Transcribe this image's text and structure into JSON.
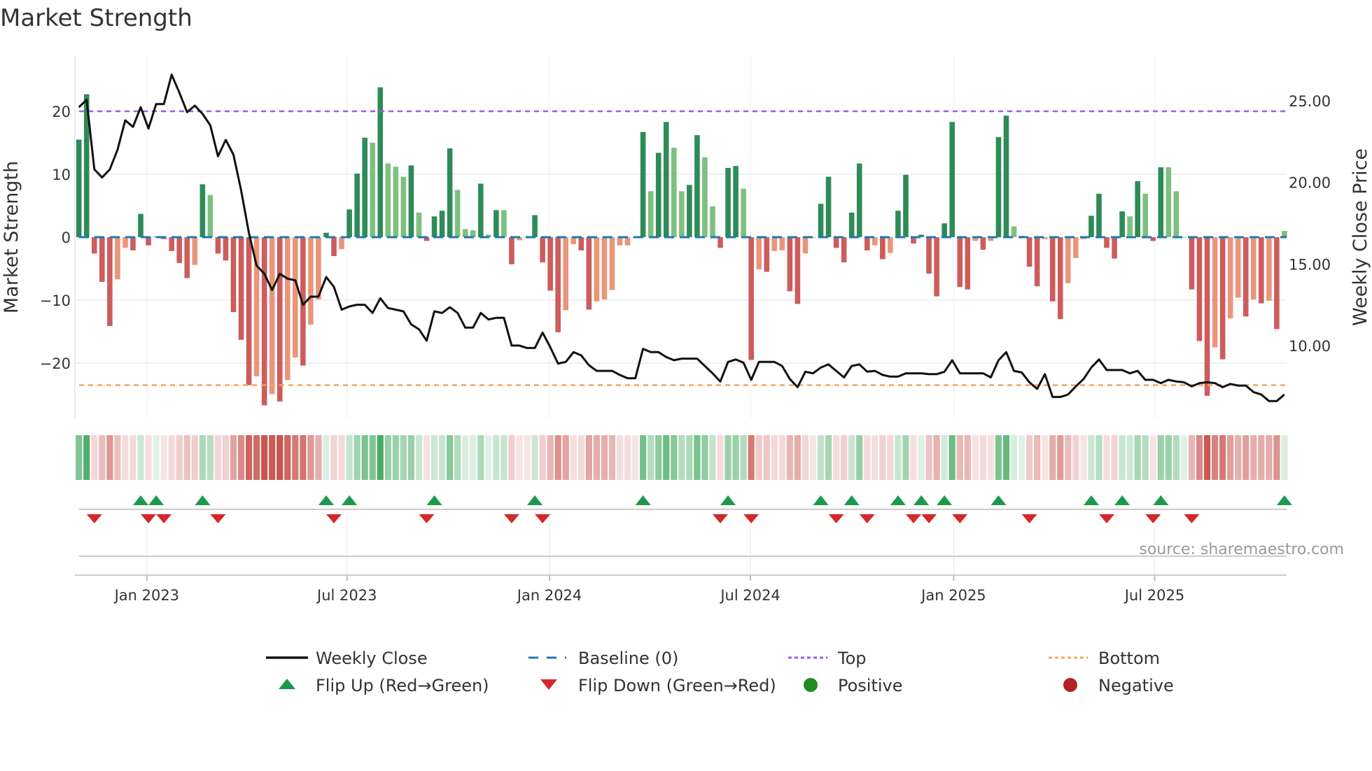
{
  "title": "Market Strength",
  "source": "source: sharemaestro.com",
  "colors": {
    "pos_dark": "#2e8b57",
    "pos_light": "#7fbf7f",
    "neg_dark": "#cd5c5c",
    "neg_light": "#e9967a",
    "top": "#9b5de5",
    "bottom": "#f4a460",
    "baseline": "#1f77b4",
    "close": "#111111",
    "flip_up": "#1a9a4a",
    "flip_down": "#d62728",
    "positive": "#228b22",
    "negative": "#b22222"
  },
  "chart_data": {
    "type": "bar",
    "title": "Market Strength",
    "ylabel": "Market Strength",
    "y2label": "Weekly Close Price",
    "ylim": [
      -28,
      27
    ],
    "y2lim": [
      6.0,
      26.8
    ],
    "yticks": [
      "20",
      "10",
      "0",
      "−10",
      "−20"
    ],
    "ytick_values": [
      20,
      10,
      0,
      -10,
      -20
    ],
    "y2ticks": [
      "25.00",
      "20.00",
      "15.00",
      "10.00"
    ],
    "y2tick_values": [
      25,
      20,
      15,
      10
    ],
    "xticks": [
      "Jan 2023",
      "Jul 2023",
      "Jan 2024",
      "Jul 2024",
      "Jan 2025",
      "Jul 2025"
    ],
    "xtick_week_index": [
      8.8,
      34.7,
      60.9,
      86.9,
      113.2,
      139.2
    ],
    "top_level": 20.0,
    "bottom_level": -23.5,
    "baseline": 0,
    "strength": [
      15.5,
      22.7,
      -2.6,
      -7.1,
      -14.1,
      -6.7,
      -1.7,
      -2.1,
      3.7,
      -1.3,
      0.1,
      -0.3,
      -2.2,
      -4.1,
      -6.5,
      -4.4,
      8.4,
      6.7,
      -2.6,
      -3.7,
      -11.9,
      -16.3,
      -23.5,
      -22.1,
      -26.7,
      -24.9,
      -26.1,
      -22.7,
      -19.1,
      -20.4,
      -13.9,
      -9.9,
      0.7,
      -3.0,
      -1.9,
      4.4,
      10.1,
      15.8,
      15.0,
      23.8,
      11.7,
      11.2,
      9.6,
      11.4,
      3.9,
      -0.6,
      3.3,
      4.2,
      14.1,
      7.5,
      1.3,
      1.1,
      8.5,
      0.4,
      4.3,
      4.3,
      -4.3,
      -0.5,
      -0.1,
      3.5,
      -4.0,
      -8.5,
      -15.1,
      -11.6,
      -1.1,
      -2.1,
      -11.5,
      -10.2,
      -9.9,
      -8.4,
      -1.3,
      -1.3,
      -0.1,
      16.7,
      7.3,
      13.4,
      18.3,
      14.2,
      7.3,
      8.3,
      16.2,
      12.7,
      4.9,
      -1.7,
      11.0,
      11.3,
      7.7,
      -19.5,
      -5.1,
      -5.5,
      -2.2,
      -2.1,
      -8.6,
      -10.6,
      -2.6,
      -0.1,
      5.3,
      9.6,
      -1.7,
      -4.0,
      3.9,
      11.7,
      -2.1,
      -1.3,
      -3.5,
      -2.5,
      4.2,
      9.9,
      -1.0,
      0.4,
      -5.8,
      -9.4,
      2.2,
      18.3,
      -7.9,
      -8.3,
      -0.6,
      -2.0,
      -0.6,
      15.9,
      19.3,
      1.7,
      0.2,
      -4.7,
      -7.8,
      -0.3,
      -10.2,
      -13.0,
      -7.3,
      -3.3,
      -0.3,
      3.4,
      6.9,
      -1.7,
      -3.4,
      4.1,
      3.3,
      8.9,
      6.9,
      -0.6,
      11.1,
      11.1,
      7.3,
      0.05,
      -8.3,
      -16.5,
      -25.2,
      -17.5,
      -19.4,
      -12.9,
      -9.6,
      -12.6,
      -9.9,
      -10.5,
      -10.1,
      -14.6,
      1.0
    ],
    "shade": "DDDDDLLDDDDDDDDLDLDDDDDLDLDLLDLLDDLDDDLDLLLDLDDDDLLLDLDLDLLDDDDLLDDLLLLLLDLDDLLDDLLDDDLDLDLLDDLLDDDDDDDLDLDDDDDDDDDDLDLDDLDDDLDDLLLDDDDDLDLDDLLLDDDLDLLDLDLDLD",
    "weekly_close": [
      24.6,
      25.06,
      20.8,
      20.3,
      20.8,
      22.0,
      23.8,
      23.4,
      24.6,
      23.3,
      24.8,
      24.8,
      26.6,
      25.5,
      24.3,
      24.7,
      24.2,
      23.5,
      21.6,
      22.6,
      21.7,
      19.5,
      16.9,
      14.9,
      14.4,
      13.4,
      14.4,
      14.1,
      14.0,
      12.5,
      13.0,
      13.0,
      14.2,
      13.6,
      12.2,
      12.4,
      12.5,
      12.5,
      12.0,
      12.9,
      12.3,
      12.2,
      12.1,
      11.3,
      11.0,
      10.3,
      12.1,
      12.0,
      12.35,
      12.0,
      11.1,
      11.1,
      12.0,
      11.6,
      11.7,
      11.7,
      10.0,
      10.0,
      9.85,
      9.85,
      10.8,
      9.9,
      8.9,
      9.0,
      9.6,
      9.4,
      8.8,
      8.45,
      8.45,
      8.45,
      8.2,
      8.0,
      8.0,
      9.8,
      9.6,
      9.6,
      9.3,
      9.1,
      9.2,
      9.2,
      9.2,
      8.75,
      8.3,
      7.8,
      9.0,
      9.15,
      8.95,
      7.9,
      9.0,
      9.0,
      9.0,
      8.75,
      7.95,
      7.45,
      8.4,
      8.3,
      8.65,
      8.85,
      8.45,
      8.05,
      8.75,
      8.85,
      8.4,
      8.45,
      8.2,
      8.1,
      8.1,
      8.3,
      8.3,
      8.3,
      8.25,
      8.25,
      8.4,
      9.1,
      8.3,
      8.3,
      8.3,
      8.3,
      8.05,
      9.1,
      9.6,
      8.45,
      8.35,
      7.75,
      7.35,
      8.25,
      6.85,
      6.85,
      7.0,
      7.5,
      7.95,
      8.65,
      9.15,
      8.5,
      8.5,
      8.5,
      8.3,
      8.45,
      7.9,
      7.9,
      7.7,
      7.9,
      7.8,
      7.75,
      7.5,
      7.7,
      7.75,
      7.7,
      7.45,
      7.65,
      7.55,
      7.55,
      7.15,
      7.0,
      6.6,
      6.6,
      7.0
    ],
    "legend": [
      {
        "label": "Weekly Close",
        "marker": "line"
      },
      {
        "label": "Baseline (0)",
        "marker": "dashed"
      },
      {
        "label": "Top",
        "marker": "dotted"
      },
      {
        "label": "Bottom",
        "marker": "dotted"
      },
      {
        "label": "Flip Up (Red→Green)",
        "marker": "triangle-up"
      },
      {
        "label": "Flip Down (Green→Red)",
        "marker": "triangle-down"
      },
      {
        "label": "Positive",
        "marker": "circle"
      },
      {
        "label": "Negative",
        "marker": "circle"
      }
    ],
    "legend_position": "bottom",
    "grid": true
  }
}
